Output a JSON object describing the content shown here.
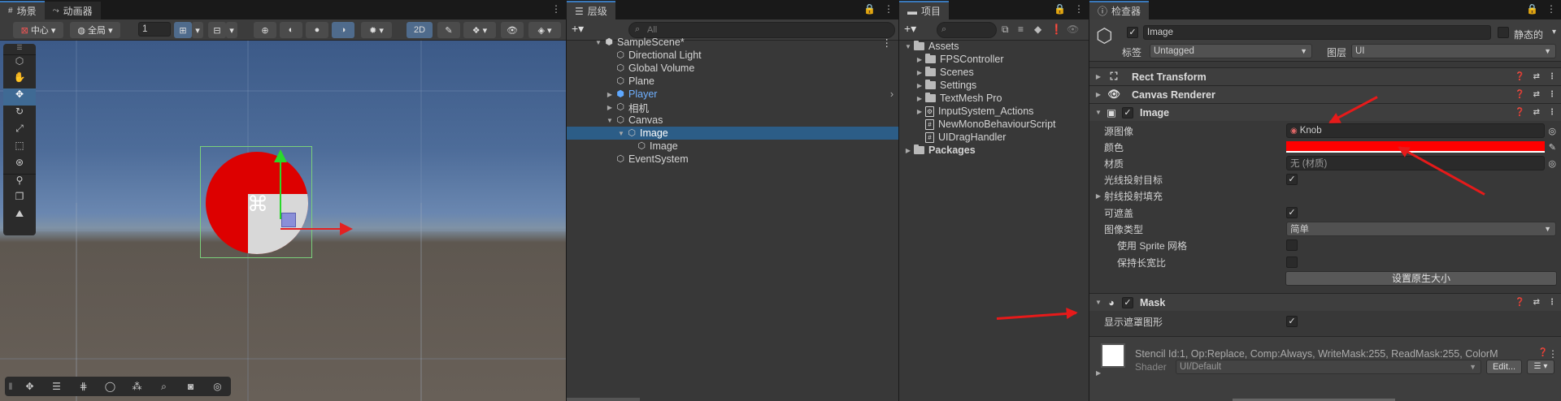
{
  "scene": {
    "tabs": [
      "场景",
      "动画器"
    ],
    "pivot": "中心",
    "space": "全局",
    "grid_value": "1",
    "mode_2d": "2D"
  },
  "hierarchy": {
    "tab": "层级",
    "search_placeholder": "All",
    "items": [
      {
        "label": "SampleScene*"
      },
      {
        "label": "Directional Light"
      },
      {
        "label": "Global Volume"
      },
      {
        "label": "Plane"
      },
      {
        "label": "Player"
      },
      {
        "label": "相机"
      },
      {
        "label": "Canvas"
      },
      {
        "label": "Image"
      },
      {
        "label": "Image"
      },
      {
        "label": "EventSystem"
      }
    ]
  },
  "project": {
    "tab": "项目",
    "items": [
      {
        "label": "Assets"
      },
      {
        "label": "FPSController"
      },
      {
        "label": "Scenes"
      },
      {
        "label": "Settings"
      },
      {
        "label": "TextMesh Pro"
      },
      {
        "label": "InputSystem_Actions"
      },
      {
        "label": "NewMonoBehaviourScript"
      },
      {
        "label": "UIDragHandler"
      },
      {
        "label": "Packages"
      }
    ]
  },
  "inspector": {
    "tab": "检查器",
    "object_name": "Image",
    "static_label": "静态的",
    "tag_label": "标签",
    "tag_value": "Untagged",
    "layer_label": "图层",
    "layer_value": "UI",
    "components": {
      "rect_transform": "Rect Transform",
      "canvas_renderer": "Canvas Renderer",
      "image": "Image",
      "mask": "Mask"
    },
    "image_props": {
      "source_label": "源图像",
      "source_value": "Knob",
      "color_label": "颜色",
      "material_label": "材质",
      "material_value": "无 (材质)",
      "raycast_target_label": "光线投射目标",
      "raycast_padding_label": "射线投射填充",
      "maskable_label": "可遮盖",
      "image_type_label": "图像类型",
      "image_type_value": "简单",
      "use_sprite_mesh_label": "使用 Sprite 网格",
      "preserve_aspect_label": "保持长宽比",
      "native_size_button": "设置原生大小"
    },
    "mask_props": {
      "show_graphic_label": "显示遮罩图形"
    },
    "material_preview": {
      "stencil_text": "Stencil Id:1, Op:Replace, Comp:Always, WriteMask:255, ReadMask:255, ColorM",
      "shader_label": "Shader",
      "shader_value": "UI/Default",
      "edit_button": "Edit..."
    }
  },
  "colors": {
    "accent": "#3a79bb",
    "image_color": "#ff0000",
    "annotation": "#e61a1a"
  }
}
